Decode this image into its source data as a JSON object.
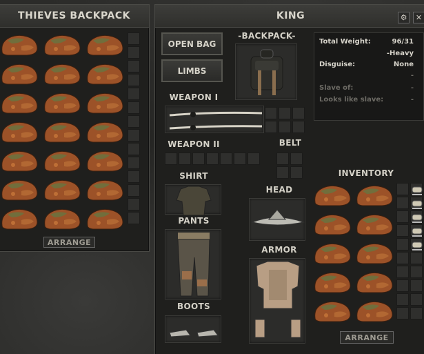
{
  "left_panel": {
    "title": "THIEVES BACKPACK",
    "arrange_label": "ARRANGE",
    "item_icon": "ore-rock-icon",
    "item_rows": 7,
    "item_cols": 3
  },
  "right_panel": {
    "title": "KING",
    "header_icons": [
      "settings-icon",
      "close-icon"
    ],
    "open_bag_label": "OPEN BAG",
    "limbs_label": "LIMBS",
    "backpack_label": "-BACKPACK-",
    "weapon1_label": "WEAPON I",
    "weapon2_label": "WEAPON II",
    "belt_label": "BELT",
    "shirt_label": "SHIRT",
    "pants_label": "PANTS",
    "head_label": "HEAD",
    "armor_label": "ARMOR",
    "boots_label": "BOOTS",
    "inventory_label": "INVENTORY",
    "inventory_arrange_label": "ARRANGE",
    "stats": {
      "total_weight_label": "Total Weight:",
      "total_weight_value": "96/31",
      "weight_status": "-Heavy",
      "disguise_label": "Disguise:",
      "disguise_value": "None",
      "disguise_sub": "-",
      "slave_of_label": "Slave of:",
      "slave_of_value": "-",
      "looks_like_slave_label": "Looks like slave:",
      "looks_like_slave_value": "-"
    }
  },
  "colors": {
    "panel_bg": "#1f1f1d",
    "rock_orange": "#a8542a",
    "rock_green": "#5c6b3a",
    "text": "#d3d0c6"
  }
}
